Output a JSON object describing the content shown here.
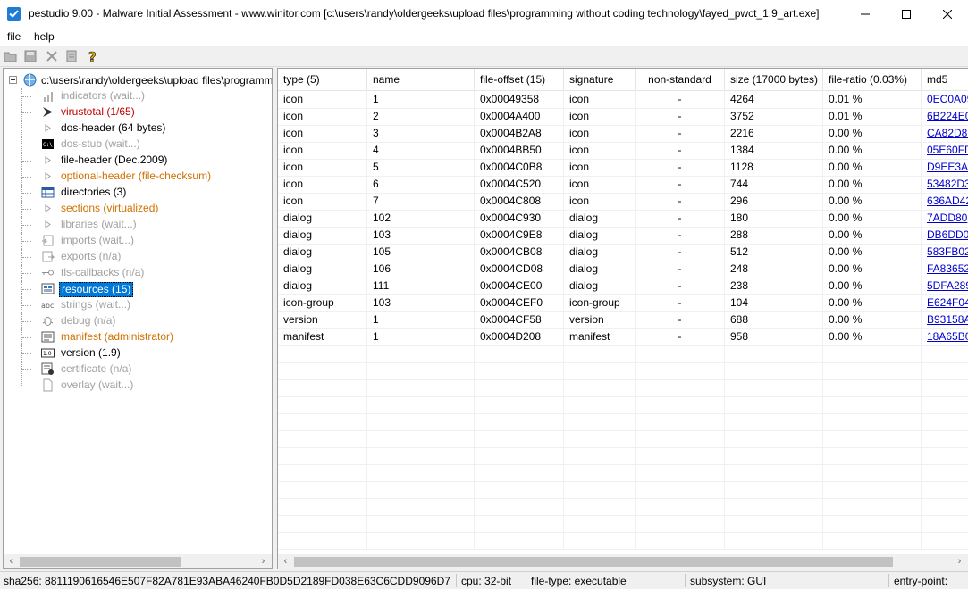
{
  "window": {
    "title": "pestudio 9.00 - Malware Initial Assessment - www.winitor.com [c:\\users\\randy\\oldergeeks\\upload files\\programming without coding technology\\fayed_pwct_1.9_art.exe]"
  },
  "menu": {
    "file": "file",
    "help": "help"
  },
  "tree": {
    "root": "c:\\users\\randy\\oldergeeks\\upload files\\programming without coding technology\\fayed_pwct_1.9_art.exe",
    "items": [
      {
        "label": "indicators (wait...)",
        "icon": "bars-icon",
        "color": "gray"
      },
      {
        "label": "virustotal (1/65)",
        "icon": "virustotal-icon",
        "color": "red"
      },
      {
        "label": "dos-header (64 bytes)",
        "icon": "triangle-icon",
        "color": "black"
      },
      {
        "label": "dos-stub (wait...)",
        "icon": "console-icon",
        "color": "gray"
      },
      {
        "label": "file-header (Dec.2009)",
        "icon": "triangle-icon",
        "color": "black"
      },
      {
        "label": "optional-header (file-checksum)",
        "icon": "triangle-icon",
        "color": "orange"
      },
      {
        "label": "directories (3)",
        "icon": "grid-icon",
        "color": "black"
      },
      {
        "label": "sections (virtualized)",
        "icon": "triangle-icon",
        "color": "orange"
      },
      {
        "label": "libraries (wait...)",
        "icon": "triangle-icon",
        "color": "gray"
      },
      {
        "label": "imports (wait...)",
        "icon": "imports-icon",
        "color": "gray"
      },
      {
        "label": "exports (n/a)",
        "icon": "exports-icon",
        "color": "gray"
      },
      {
        "label": "tls-callbacks (n/a)",
        "icon": "key-icon",
        "color": "gray"
      },
      {
        "label": "resources (15)",
        "icon": "resources-icon",
        "color": "selected"
      },
      {
        "label": "strings (wait...)",
        "icon": "abc-icon",
        "color": "gray"
      },
      {
        "label": "debug (n/a)",
        "icon": "bug-icon",
        "color": "gray"
      },
      {
        "label": "manifest (administrator)",
        "icon": "manifest-icon",
        "color": "orange"
      },
      {
        "label": "version (1.9)",
        "icon": "version-icon",
        "color": "black"
      },
      {
        "label": "certificate (n/a)",
        "icon": "certificate-icon",
        "color": "gray"
      },
      {
        "label": "overlay (wait...)",
        "icon": "page-icon",
        "color": "gray"
      }
    ]
  },
  "table": {
    "columns": [
      "type (5)",
      "name",
      "file-offset (15)",
      "signature",
      "non-standard",
      "size (17000 bytes)",
      "file-ratio (0.03%)",
      "md5"
    ],
    "rows": [
      [
        "icon",
        "1",
        "0x00049358",
        "icon",
        "-",
        "4264",
        "0.01 %",
        "0EC0A09"
      ],
      [
        "icon",
        "2",
        "0x0004A400",
        "icon",
        "-",
        "3752",
        "0.01 %",
        "6B224E0"
      ],
      [
        "icon",
        "3",
        "0x0004B2A8",
        "icon",
        "-",
        "2216",
        "0.00 %",
        "CA82D89"
      ],
      [
        "icon",
        "4",
        "0x0004BB50",
        "icon",
        "-",
        "1384",
        "0.00 %",
        "05E60FD"
      ],
      [
        "icon",
        "5",
        "0x0004C0B8",
        "icon",
        "-",
        "1128",
        "0.00 %",
        "D9EE3A2"
      ],
      [
        "icon",
        "6",
        "0x0004C520",
        "icon",
        "-",
        "744",
        "0.00 %",
        "53482D3"
      ],
      [
        "icon",
        "7",
        "0x0004C808",
        "icon",
        "-",
        "296",
        "0.00 %",
        "636AD42"
      ],
      [
        "dialog",
        "102",
        "0x0004C930",
        "dialog",
        "-",
        "180",
        "0.00 %",
        "7ADD80"
      ],
      [
        "dialog",
        "103",
        "0x0004C9E8",
        "dialog",
        "-",
        "288",
        "0.00 %",
        "DB6DD0"
      ],
      [
        "dialog",
        "105",
        "0x0004CB08",
        "dialog",
        "-",
        "512",
        "0.00 %",
        "583FB02"
      ],
      [
        "dialog",
        "106",
        "0x0004CD08",
        "dialog",
        "-",
        "248",
        "0.00 %",
        "FA83652"
      ],
      [
        "dialog",
        "111",
        "0x0004CE00",
        "dialog",
        "-",
        "238",
        "0.00 %",
        "5DFA289"
      ],
      [
        "icon-group",
        "103",
        "0x0004CEF0",
        "icon-group",
        "-",
        "104",
        "0.00 %",
        "E624F04"
      ],
      [
        "version",
        "1",
        "0x0004CF58",
        "version",
        "-",
        "688",
        "0.00 %",
        "B93158A"
      ],
      [
        "manifest",
        "1",
        "0x0004D208",
        "manifest",
        "-",
        "958",
        "0.00 %",
        "18A65B0"
      ]
    ]
  },
  "status": {
    "sha256": "sha256: 8811190616546E507F82A781E93ABA46240FB0D5D2189FD038E63C6CDD9096D7",
    "cpu": "cpu: 32-bit",
    "file_type": "file-type: executable",
    "subsystem": "subsystem: GUI",
    "entry_point": "entry-point:"
  },
  "colors": {
    "selection": "#0078d7",
    "link": "#0000cc",
    "orange": "#d07000",
    "red": "#c00000",
    "gray": "#a0a0a0"
  }
}
